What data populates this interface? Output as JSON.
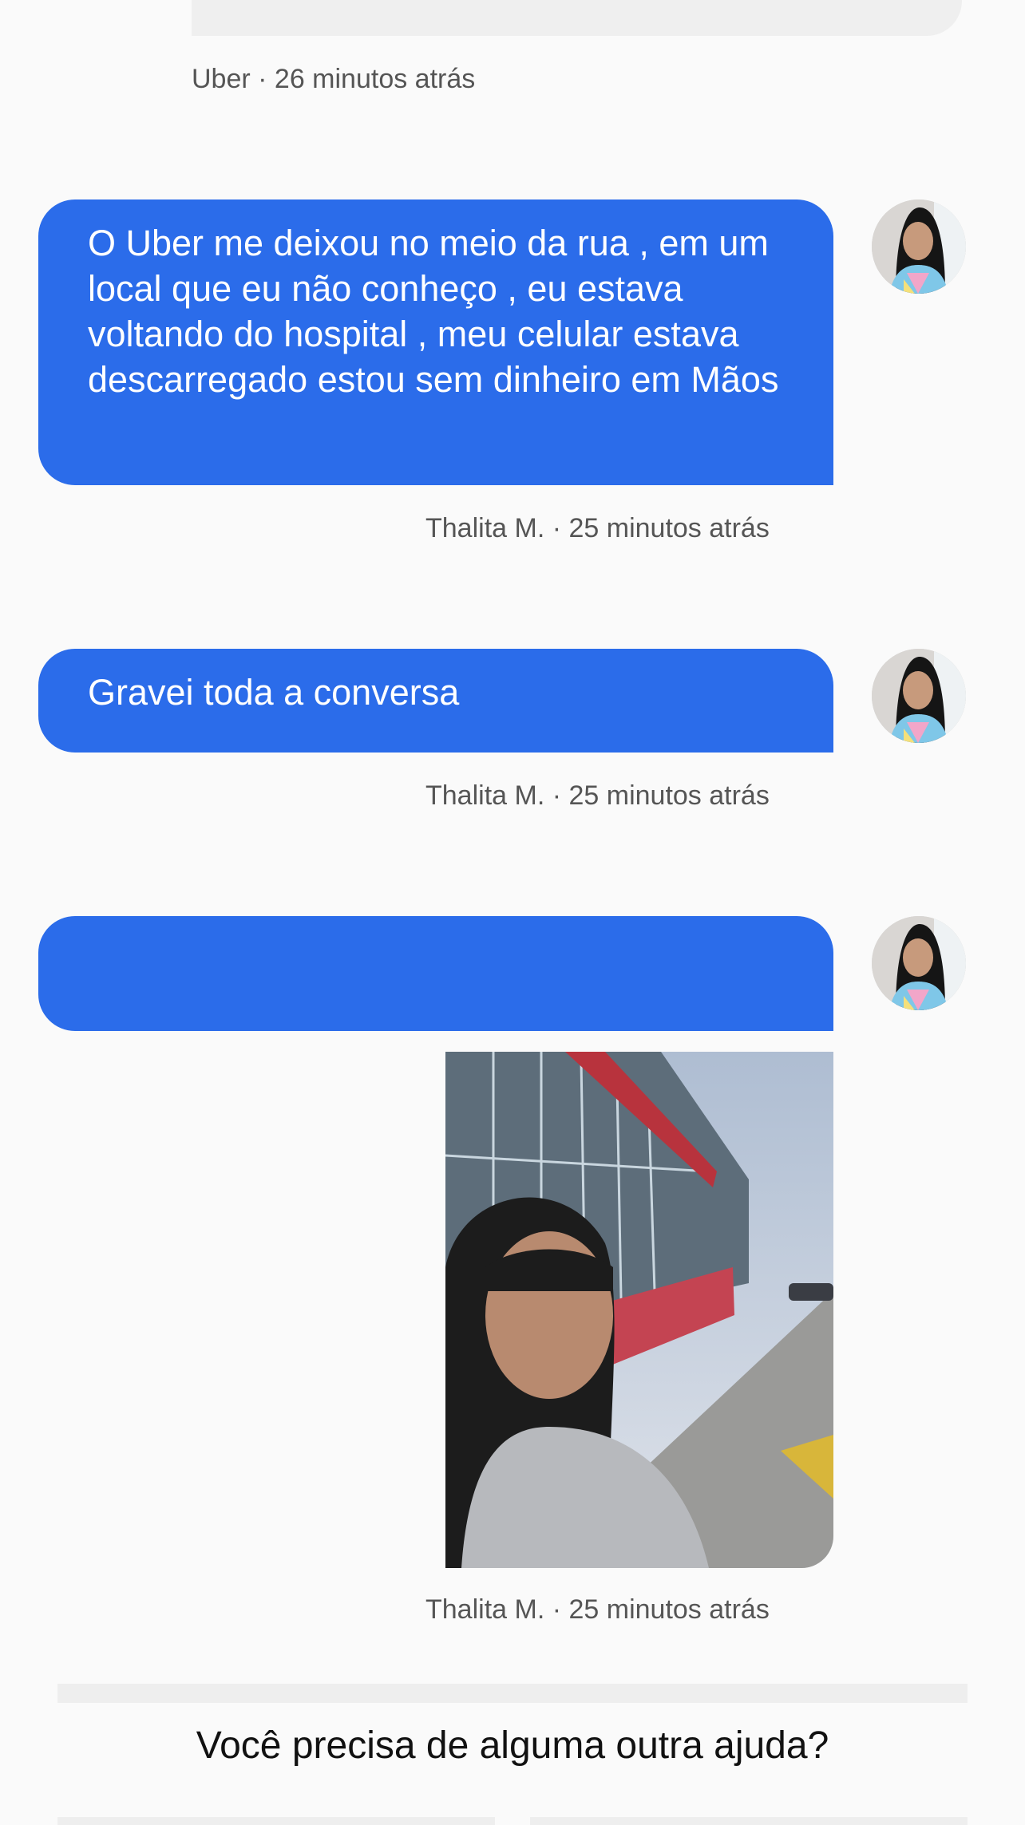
{
  "thread": {
    "previous_meta": "Uber · 26 minutos atrás",
    "messages": [
      {
        "text": "O Uber me deixou no meio da rua , em um local que eu não conheço , eu estava voltando do hospital , meu celular estava descarregado estou sem dinheiro em Mãos",
        "meta": "Thalita M. · 25 minutos atrás"
      },
      {
        "text": "Gravei toda a conversa",
        "meta": "Thalita M. · 25 minutos atrás"
      },
      {
        "text": "",
        "meta": "Thalita M. · 25 minutos atrás"
      }
    ]
  },
  "footer": {
    "question": "Você precisa de alguma outra ajuda?"
  },
  "colors": {
    "bubble": "#2b6cea",
    "background": "#fafafa",
    "meta_text": "#555555"
  },
  "icons": {
    "avatar": "user-avatar-photo",
    "attachment": "photo-attachment"
  }
}
